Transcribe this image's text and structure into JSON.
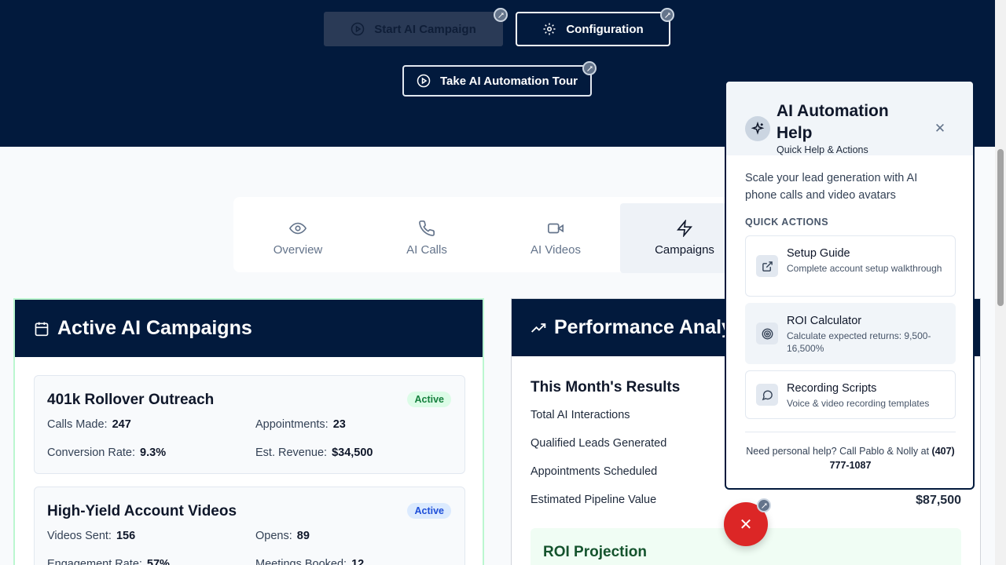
{
  "hero": {
    "start_label": "Start AI Campaign",
    "config_label": "Configuration",
    "tour_label": "Take AI Automation Tour"
  },
  "tabs": [
    {
      "label": "Overview",
      "icon": "eye-icon"
    },
    {
      "label": "AI Calls",
      "icon": "phone-icon"
    },
    {
      "label": "AI Videos",
      "icon": "video-icon"
    },
    {
      "label": "Campaigns",
      "icon": "zap-icon",
      "active": true
    }
  ],
  "campaigns_card": {
    "title": "Active AI Campaigns",
    "items": [
      {
        "name": "401k Rollover Outreach",
        "status": "Active",
        "stats": [
          {
            "label": "Calls Made:",
            "value": "247"
          },
          {
            "label": "Appointments:",
            "value": "23"
          },
          {
            "label": "Conversion Rate:",
            "value": "9.3%"
          },
          {
            "label": "Est. Revenue:",
            "value": "$34,500"
          }
        ]
      },
      {
        "name": "High-Yield Account Videos",
        "status": "Active",
        "stats": [
          {
            "label": "Videos Sent:",
            "value": "156"
          },
          {
            "label": "Opens:",
            "value": "89"
          },
          {
            "label": "Engagement Rate:",
            "value": "57%"
          },
          {
            "label": "Meetings Booked:",
            "value": "12"
          }
        ]
      }
    ]
  },
  "performance_card": {
    "title": "Performance Analytics",
    "month_title": "This Month's Results",
    "rows": [
      {
        "label": "Total AI Interactions",
        "value": ""
      },
      {
        "label": "Qualified Leads Generated",
        "value": ""
      },
      {
        "label": "Appointments Scheduled",
        "value": ""
      },
      {
        "label": "Estimated Pipeline Value",
        "value": "$87,500"
      }
    ],
    "roi_title": "ROI Projection"
  },
  "help_panel": {
    "title": "AI Automation Help",
    "subtitle": "Quick Help & Actions",
    "intro": "Scale your lead generation with AI phone calls and video avatars",
    "section_label": "QUICK ACTIONS",
    "actions": [
      {
        "title": "Setup Guide",
        "desc": "Complete account setup walkthrough",
        "icon": "external-link-icon"
      },
      {
        "title": "ROI Calculator",
        "desc": "Calculate expected returns: 9,500-16,500%",
        "icon": "target-icon"
      },
      {
        "title": "Recording Scripts",
        "desc": "Voice & video recording templates",
        "icon": "message-circle-icon"
      }
    ],
    "footer_text": "Need personal help? Call Pablo & Nolly at",
    "footer_phone": "(407) 777-1087"
  },
  "colors": {
    "navy": "#021a3d",
    "accent_red": "#dc2626",
    "active_green": "#15803d",
    "active_blue": "#1d4ed8"
  }
}
